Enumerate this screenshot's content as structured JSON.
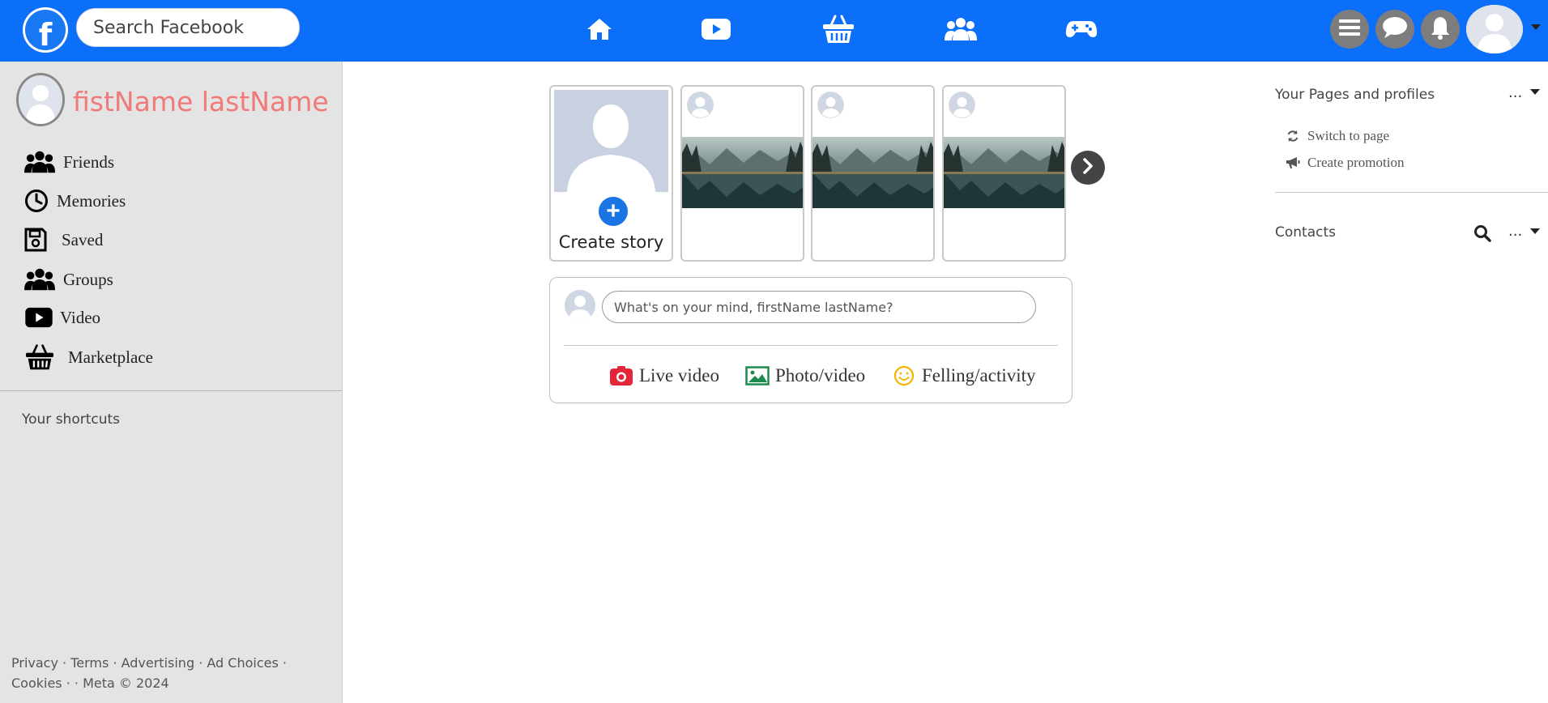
{
  "header": {
    "logo_letter": "f",
    "search_placeholder": "Search Facebook",
    "nav_icons": [
      "home-icon",
      "video-icon",
      "marketplace-icon",
      "groups-icon",
      "gaming-icon"
    ],
    "right_icons": [
      "menu-icon",
      "messenger-icon",
      "bell-icon"
    ],
    "brand_color": "#0c6ff9"
  },
  "profile": {
    "name": "fistName lastName",
    "name_color": "#f07a7a"
  },
  "sidebar": {
    "items": [
      {
        "label": "Friends",
        "icon": "friends-icon"
      },
      {
        "label": "Memories",
        "icon": "clock-icon"
      },
      {
        "label": "Saved",
        "icon": "floppy-icon"
      },
      {
        "label": "Groups",
        "icon": "groups-icon"
      },
      {
        "label": "Video",
        "icon": "video-icon"
      },
      {
        "label": "Marketplace",
        "icon": "basket-icon"
      }
    ],
    "shortcuts_label": "Your shortcuts",
    "footer": {
      "links": [
        "Privacy",
        "Terms",
        "Advertising",
        "Ad Choices",
        "Cookies"
      ],
      "copyright": "Meta © 2024"
    }
  },
  "stories": {
    "create_label": "Create story"
  },
  "composer": {
    "placeholder": "What's on your mind, firstName lastName?",
    "actions": [
      {
        "label": "Live video",
        "icon": "camera-icon",
        "color": "#e4253a"
      },
      {
        "label": "Photo/video",
        "icon": "photo-icon",
        "color": "#1d8a4e"
      },
      {
        "label": "Felling/activity",
        "icon": "smile-icon",
        "color": "#f4b400"
      }
    ]
  },
  "right_column": {
    "pages_title": "Your Pages and profiles",
    "more_label": "...",
    "links": [
      {
        "label": "Switch to page",
        "icon": "refresh-icon"
      },
      {
        "label": "Create promotion",
        "icon": "megaphone-icon"
      }
    ],
    "contacts_title": "Contacts"
  }
}
